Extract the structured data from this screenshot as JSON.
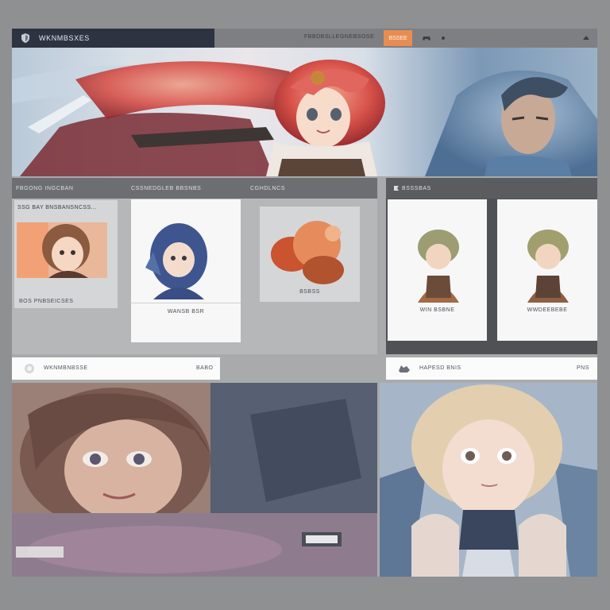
{
  "topbar": {
    "brand_name": "WKNMBSXES",
    "nav_link": "FBBDBSLLEGNEBSOSE",
    "nav_button": "BSSEE",
    "icons": [
      "shield-logo-icon",
      "game-controller-icon",
      "notification-icon",
      "caret-up-icon"
    ]
  },
  "sections": {
    "left_headers": [
      "FBGONG INGCBAN",
      "CSSNEDGLEB BBSNBS",
      "CGHDLNCS"
    ],
    "right_header": "BSSSBAS",
    "right_header_icon": "flag-icon"
  },
  "cards": {
    "card1_title": "SSG BAY BNSBANSNCSS...",
    "card1_caption": "BOS PNBSEICSES",
    "card2_caption": "WANSB BSR",
    "card3_caption": "BSBSS",
    "card4_caption": "WIN BSBNE",
    "card5_caption": "WWDEEBEBE"
  },
  "search_left": {
    "label": "WKNMBNBSSE",
    "right_text": "BABO"
  },
  "search_right": {
    "label": "HAPESD BNIS",
    "right_text": "PNS"
  },
  "colors": {
    "accent": "#e88d52",
    "brand_bg": "#2d3340",
    "panel_dark": "#4f5154"
  }
}
